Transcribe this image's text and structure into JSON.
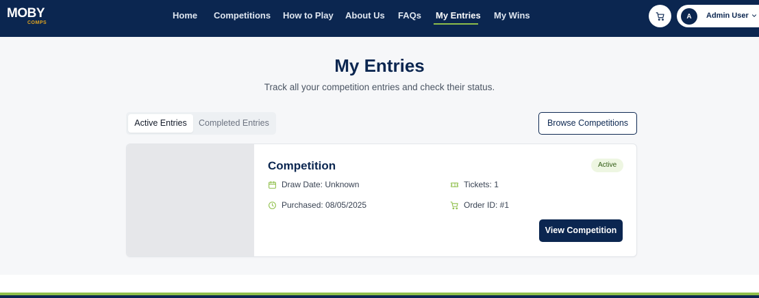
{
  "brand": {
    "logo_main": "MOBY",
    "logo_sub": "COMPS"
  },
  "nav": {
    "items": [
      "Home",
      "Competitions",
      "How to Play",
      "About Us",
      "FAQs",
      "My Entries",
      "My Wins"
    ],
    "active": "My Entries"
  },
  "header": {
    "cart_icon": "cart-icon",
    "user_initial": "A",
    "user_name": "Admin User",
    "chevron_icon": "chevron-down-icon"
  },
  "page": {
    "title": "My Entries",
    "subtitle": "Track all your competition entries and check their status."
  },
  "tabs": {
    "active": "Active Entries",
    "inactive": "Completed Entries"
  },
  "browse_button": "Browse Competitions",
  "entry": {
    "title": "Competition",
    "status": "Active",
    "draw_date": "Draw Date: Unknown",
    "tickets": "Tickets: 1",
    "purchased": "Purchased: 08/05/2025",
    "order_id": "Order ID: #1",
    "view_button": "View Competition"
  },
  "colors": {
    "brand_navy": "#0b2650",
    "accent_green": "#8fbf4a",
    "logo_gold": "#e0a420",
    "badge_bg": "#eef6e2"
  }
}
